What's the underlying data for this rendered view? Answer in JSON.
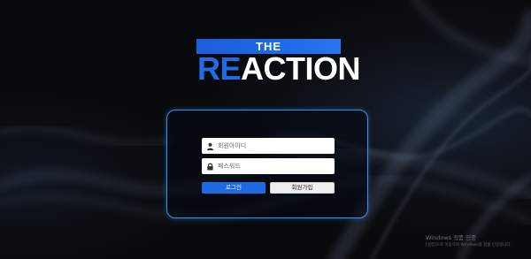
{
  "logo": {
    "top_text": "THE",
    "word_accent": "RE",
    "word_rest": "ACTION"
  },
  "login": {
    "id_placeholder": "회원아이디",
    "pw_placeholder": "패스워드",
    "login_label": "로그인",
    "join_label": "회원가입",
    "icons": {
      "id": "user-icon",
      "pw": "lock-icon"
    }
  },
  "watermark": {
    "title": "Windows 정품 인증",
    "subtitle": "[설정]으로 이동하여 Windows를 정품 인증합니다."
  },
  "colors": {
    "accent": "#1f6ae8",
    "box_border": "#3d8df0",
    "background": "#08090c"
  }
}
